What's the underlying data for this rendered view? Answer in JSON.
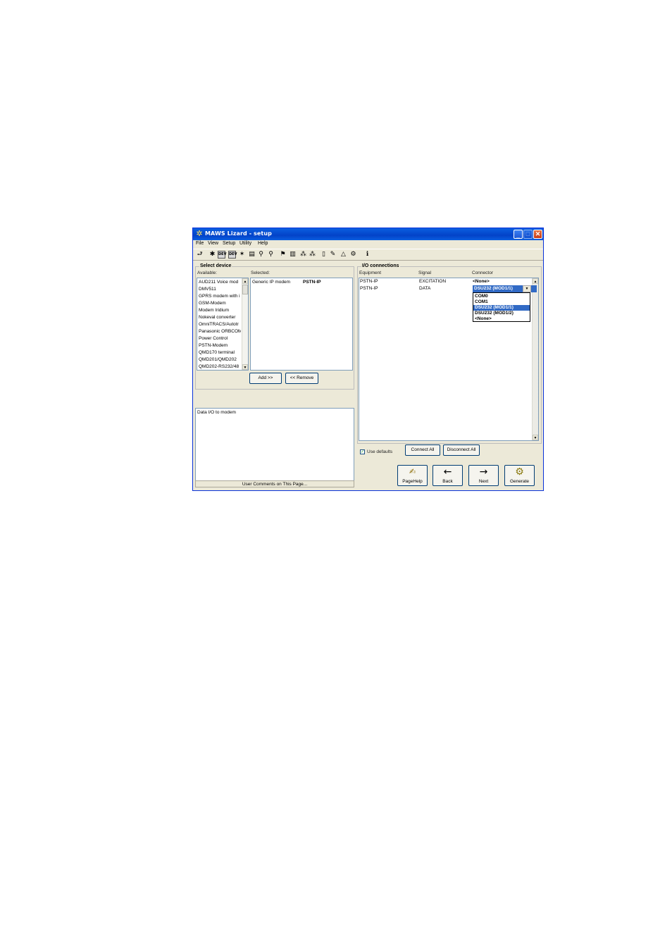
{
  "window": {
    "title": "MAWS Lizard - setup",
    "accent": "#0a5fe0",
    "minimize_glyph": "_",
    "maximize_glyph": "□",
    "close_glyph": "✕"
  },
  "menu": [
    "File",
    "View",
    "Setup",
    "Utility",
    "Help"
  ],
  "toolbar": {
    "icons": [
      {
        "name": "back-arrow-icon",
        "glyph": "⮐"
      },
      {
        "name": "chip-icon",
        "glyph": "✱"
      },
      {
        "name": "device-icon",
        "glyph": "DEV"
      },
      {
        "name": "device-icon",
        "glyph": "DEV"
      },
      {
        "name": "star-icon",
        "glyph": "✶"
      },
      {
        "name": "display-icon",
        "glyph": "▤"
      },
      {
        "name": "person-icon",
        "glyph": "⚲"
      },
      {
        "name": "person-icon",
        "glyph": "⚲"
      },
      {
        "name": "flag-icon",
        "glyph": "⚑"
      },
      {
        "name": "bars-icon",
        "glyph": "▥"
      },
      {
        "name": "network-icon",
        "glyph": "⁂"
      },
      {
        "name": "network-icon",
        "glyph": "⁂"
      },
      {
        "name": "page-icon",
        "glyph": "▯"
      },
      {
        "name": "pencil-icon",
        "glyph": "✎"
      },
      {
        "name": "bell-icon",
        "glyph": "△"
      },
      {
        "name": "gear-icon",
        "glyph": "⚙"
      },
      {
        "name": "info-icon",
        "glyph": "ℹ"
      }
    ]
  },
  "select_device": {
    "title": "Select device",
    "available_label": "Available:",
    "selected_label": "Selected:",
    "available": [
      "AUD211 Voice mod",
      "DMV511",
      "GPRS modem with i",
      "GSM-Modem",
      "Modem Iridium",
      "Nokeval converter",
      "OmniTRACS/Autotr",
      "Panasonic ORBCOM",
      "Power Control",
      "PSTN-Modem",
      "QMD170 terminal",
      "QMD201/QMD202",
      "QMD202-RS232/48"
    ],
    "selected": [
      {
        "device": "Generic IP modem",
        "name": "PSTN-IP"
      }
    ],
    "add_label": "Add >>",
    "remove_label": "<< Remove"
  },
  "comments": {
    "text": "Data I/O to modem",
    "status": "User Comments on This Page..."
  },
  "io_connections": {
    "title": "I/O connections",
    "headers": {
      "equipment": "Equipment",
      "signal": "Signal",
      "connector": "Connector"
    },
    "rows": [
      {
        "equipment": "PSTN-IP",
        "signal": "EXCITATION",
        "connector": "<None>"
      },
      {
        "equipment": "PSTN-IP",
        "signal": "DATA",
        "connector": "DSU232 (MOD1/1)"
      }
    ],
    "dropdown_options": [
      "COM0",
      "COM1",
      "DSU232 (MOD1/1)",
      "DSU232 (MOD1/2)",
      "<None>"
    ],
    "dropdown_selected_index": 2,
    "use_defaults_label": "Use defaults",
    "use_defaults_checked": true,
    "connect_all_label": "Connect All",
    "disconnect_all_label": "Disconnect All"
  },
  "nav": {
    "pagehelp_label": "PageHelp",
    "back_label": "Back",
    "next_label": "Next",
    "generate_label": "Generate",
    "pagehelp_glyph": "✍",
    "back_glyph": "←",
    "next_glyph": "→",
    "generate_glyph": "⚙"
  }
}
